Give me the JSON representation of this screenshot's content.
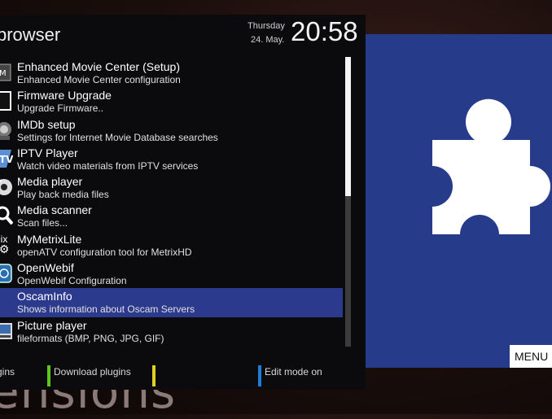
{
  "background": {
    "word": "ensions"
  },
  "header": {
    "title": "browser",
    "day": "Thursday",
    "date": "24. May.",
    "time": "20:58"
  },
  "plugins": [
    {
      "name": "Enhanced Movie Center (Setup)",
      "description": "Enhanced Movie Center configuration",
      "icon": "emc-icon"
    },
    {
      "name": "Firmware Upgrade",
      "description": "Upgrade Firmware..",
      "icon": "firmware-icon"
    },
    {
      "name": "IMDb setup",
      "description": "Settings for Internet Movie Database searches",
      "icon": "imdb-icon"
    },
    {
      "name": "IPTV Player",
      "description": "Watch video materials from IPTV services",
      "icon": "iptv-icon"
    },
    {
      "name": "Media player",
      "description": "Play back media files",
      "icon": "media-player-icon"
    },
    {
      "name": "Media scanner",
      "description": "Scan files...",
      "icon": "media-scanner-icon"
    },
    {
      "name": "MyMetrixLite",
      "description": "openATV configuration tool for MetrixHD",
      "icon": "metrix-icon",
      "icon_text": "ix"
    },
    {
      "name": "OpenWebif",
      "description": "OpenWebif Configuration",
      "icon": "openwebif-icon"
    },
    {
      "name": "OscamInfo",
      "description": "Shows information about Oscam Servers",
      "icon": "oscam-icon",
      "selected": true
    },
    {
      "name": "Picture player",
      "description": "fileformats (BMP, PNG, JPG, GIF)",
      "icon": "picture-player-icon"
    }
  ],
  "footer": {
    "red_label": "gins",
    "green_label": "Download plugins",
    "yellow_label": "",
    "blue_label": "Edit mode on",
    "colors": {
      "red": "#c02020",
      "green": "#5ac81e",
      "yellow": "#e0d020",
      "blue": "#1f7fd8"
    }
  },
  "menu_button": {
    "label": "MENU"
  },
  "preview": {
    "icon": "puzzle-piece-icon",
    "bg": "#263c8b"
  },
  "scroll": {
    "thumb_fraction": 0.48
  }
}
